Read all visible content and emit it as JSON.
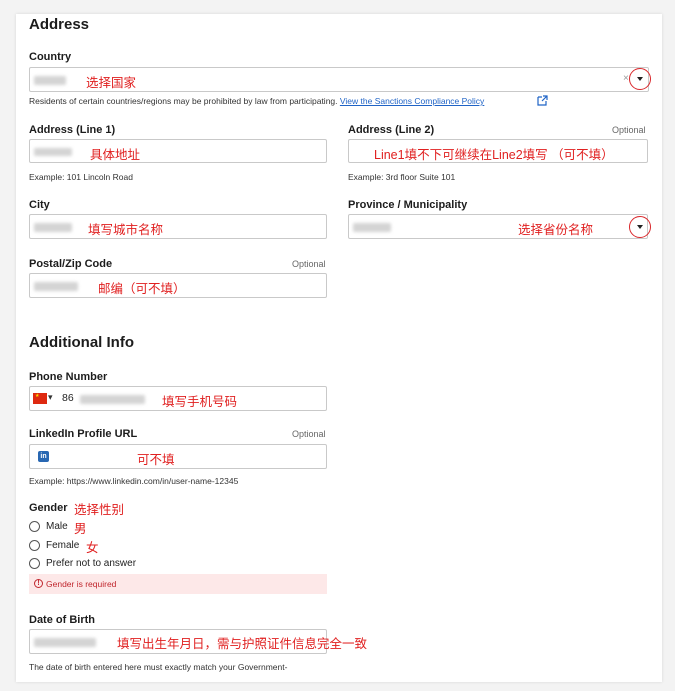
{
  "address": {
    "heading": "Address",
    "country": {
      "label": "Country",
      "annotation": "选择国家",
      "note": "Residents of certain countries/regions may be prohibited by law from participating.",
      "link": "View the Sanctions Compliance Policy"
    },
    "line1": {
      "label": "Address (Line 1)",
      "annotation": "具体地址",
      "example": "Example: 101 Lincoln Road"
    },
    "line2": {
      "label": "Address (Line 2)",
      "optional": "Optional",
      "annotation": "Line1填不下可继续在Line2填写 （可不填）",
      "example": "Example: 3rd floor Suite 101"
    },
    "city": {
      "label": "City",
      "annotation": "填写城市名称"
    },
    "province": {
      "label": "Province / Municipality",
      "annotation": "选择省份名称"
    },
    "postal": {
      "label": "Postal/Zip Code",
      "optional": "Optional",
      "annotation": "邮编（可不填）"
    }
  },
  "additional": {
    "heading": "Additional Info",
    "phone": {
      "label": "Phone Number",
      "code": "86",
      "annotation": "填写手机号码"
    },
    "linkedin": {
      "label": "LinkedIn Profile URL",
      "optional": "Optional",
      "annotation": "可不填",
      "example": "Example: https://www.linkedin.com/in/user-name-12345"
    },
    "gender": {
      "label": "Gender",
      "annotation": "选择性别",
      "options": [
        {
          "label": "Male",
          "annotation": "男"
        },
        {
          "label": "Female",
          "annotation": "女"
        },
        {
          "label": "Prefer not to answer",
          "annotation": ""
        }
      ],
      "error": "Gender is required"
    },
    "dob": {
      "label": "Date of Birth",
      "annotation": "填写出生年月日，需与护照证件信息完全一致",
      "note": "The date of birth entered here must exactly match your Government-"
    }
  },
  "colors": {
    "annotation": "#e02020",
    "link": "#1f63c6",
    "error_bg": "#fde8e8",
    "error_text": "#c0262d",
    "linkedin": "#2867b2"
  }
}
